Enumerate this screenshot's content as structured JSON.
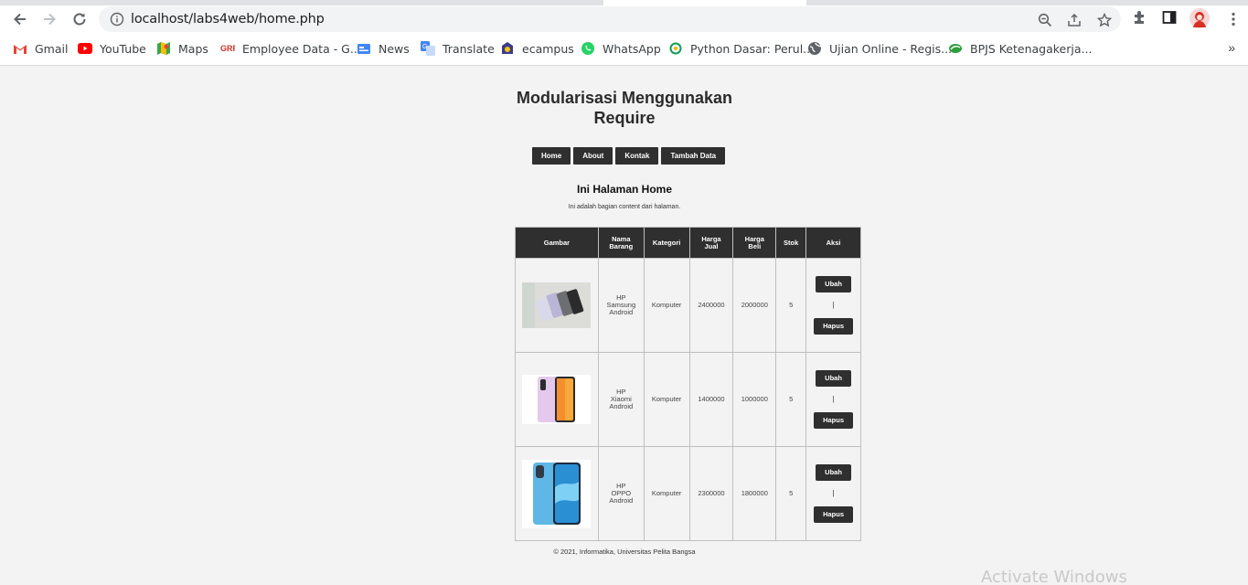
{
  "browser": {
    "url": "localhost/labs4web/home.php",
    "bookmarks": [
      {
        "label": "Gmail",
        "icon": "gmail-icon"
      },
      {
        "label": "YouTube",
        "icon": "youtube-icon"
      },
      {
        "label": "Maps",
        "icon": "maps-icon"
      },
      {
        "label": "Employee Data - G...",
        "icon": "employee-data-icon"
      },
      {
        "label": "News",
        "icon": "news-icon"
      },
      {
        "label": "Translate",
        "icon": "translate-icon"
      },
      {
        "label": "ecampus",
        "icon": "ecampus-icon"
      },
      {
        "label": "WhatsApp",
        "icon": "whatsapp-icon"
      },
      {
        "label": "Python Dasar: Perul...",
        "icon": "python-dasar-icon"
      },
      {
        "label": "Ujian Online - Regis...",
        "icon": "globe-icon"
      },
      {
        "label": "BPJS Ketenagakerja...",
        "icon": "bpjs-icon"
      }
    ],
    "more_label": "»"
  },
  "site": {
    "title_line1": "Modularisasi Menggunakan",
    "title_line2": "Require",
    "nav": [
      "Home",
      "About",
      "Kontak",
      "Tambah Data"
    ]
  },
  "content": {
    "title": "Ini Halaman Home",
    "description": "Ini adalah bagian content dari halaman."
  },
  "table": {
    "headers": {
      "gambar": "Gambar",
      "nama_line1": "Nama",
      "nama_line2": "Barang",
      "kategori": "Kategori",
      "jual_line1": "Harga",
      "jual_line2": "Jual",
      "beli_line1": "Harga",
      "beli_line2": "Beli",
      "stok": "Stok",
      "aksi": "Aksi"
    },
    "rows": [
      {
        "nama": [
          "HP",
          "Samsung",
          "Android"
        ],
        "kategori": "Komputer",
        "harga_jual": "2400000",
        "harga_beli": "2000000",
        "stok": "5",
        "image": "samsung-phones"
      },
      {
        "nama": [
          "HP",
          "Xiaomi",
          "Android"
        ],
        "kategori": "Komputer",
        "harga_jual": "1400000",
        "harga_beli": "1000000",
        "stok": "5",
        "image": "xiaomi-phone"
      },
      {
        "nama": [
          "HP",
          "OPPO",
          "Android"
        ],
        "kategori": "Komputer",
        "harga_jual": "2300000",
        "harga_beli": "1800000",
        "stok": "5",
        "image": "oppo-phone"
      }
    ],
    "ubah_label": "Ubah",
    "hapus_label": "Hapus",
    "separator": "|"
  },
  "footer": "© 2021, Informatika, Universitas Pelita Bangsa",
  "watermark": "Activate Windows",
  "colors": {
    "page_bg": "#f3f3f3",
    "dark": "#2f2f2f",
    "border": "#bfbfbf"
  }
}
